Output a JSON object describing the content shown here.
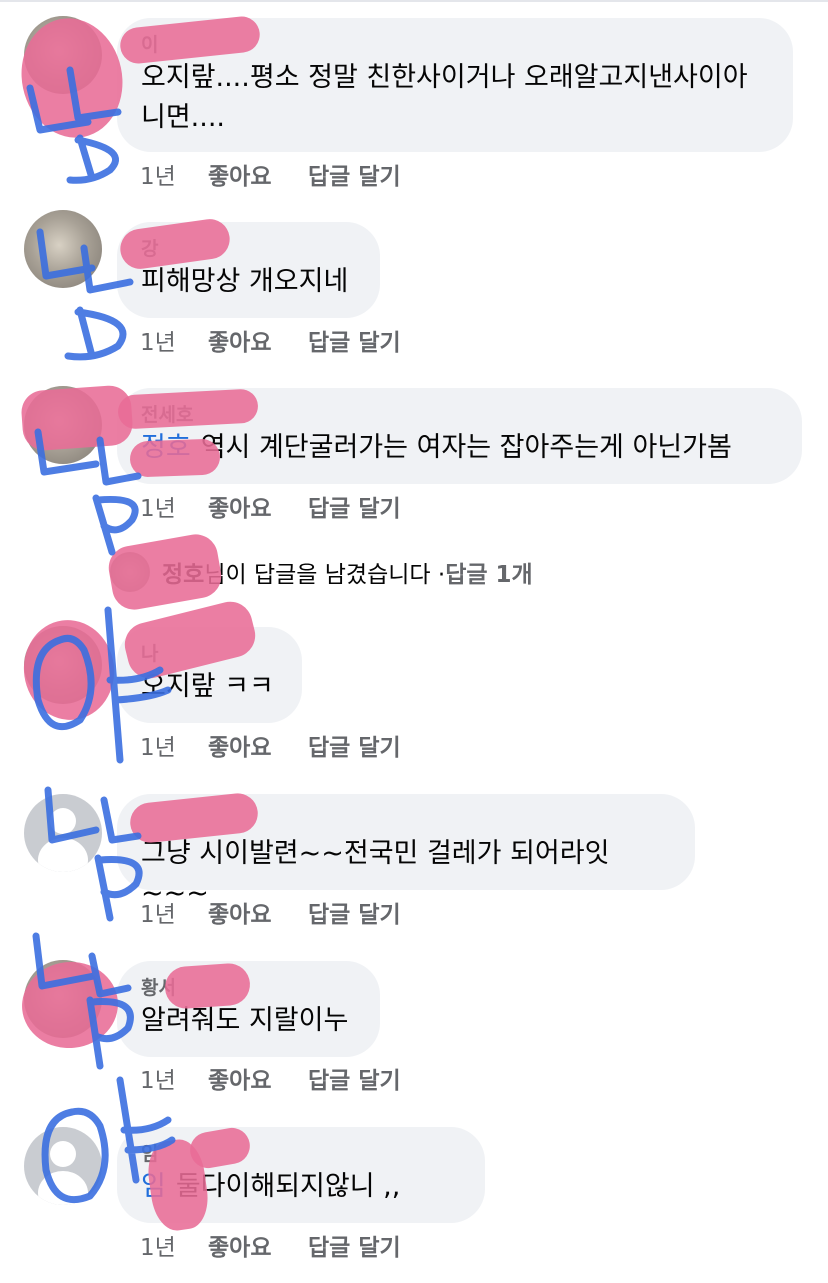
{
  "comments": [
    {
      "author": "이",
      "text": "오지랖....평소 정말 친한사이거나 오래알고지낸사이아\n니면....",
      "mention": "",
      "time": "1년",
      "like": "좋아요",
      "reply": "답글 달기"
    },
    {
      "author": "강",
      "text": "피해망상 개오지네",
      "mention": "",
      "time": "1년",
      "like": "좋아요",
      "reply": "답글 달기"
    },
    {
      "author": "전세호",
      "text": "역시 계단굴러가는 여자는 잡아주는게 아닌가봄",
      "mention": "정호",
      "time": "1년",
      "like": "좋아요",
      "reply": "답글 달기"
    },
    {
      "author": "나",
      "text": "오지랖 ㅋㅋ",
      "mention": "",
      "time": "1년",
      "like": "좋아요",
      "reply": "답글 달기"
    },
    {
      "author": "",
      "text": "그냥 시이발련~~전국민 걸레가 되어라잇~~~",
      "mention": "",
      "time": "1년",
      "like": "좋아요",
      "reply": "답글 달기"
    },
    {
      "author": "황서",
      "text": "알려줘도 지랄이누",
      "mention": "",
      "time": "1년",
      "like": "좋아요",
      "reply": "답글 달기"
    },
    {
      "author": "임",
      "text": "둘다이해되지않니 ,,",
      "mention": "임",
      "time": "1년",
      "like": "좋아요",
      "reply": "답글 달기"
    }
  ],
  "reply_summary": {
    "name": "정호",
    "suffix": "님이 답글을 남겼습니다 · ",
    "count": "답글 1개"
  },
  "colors": {
    "bubble": "#f0f2f5",
    "meta": "#65676b",
    "mention": "#216fdb",
    "redaction_pink": "#e86c96",
    "pen_blue": "#3b6fe0"
  }
}
